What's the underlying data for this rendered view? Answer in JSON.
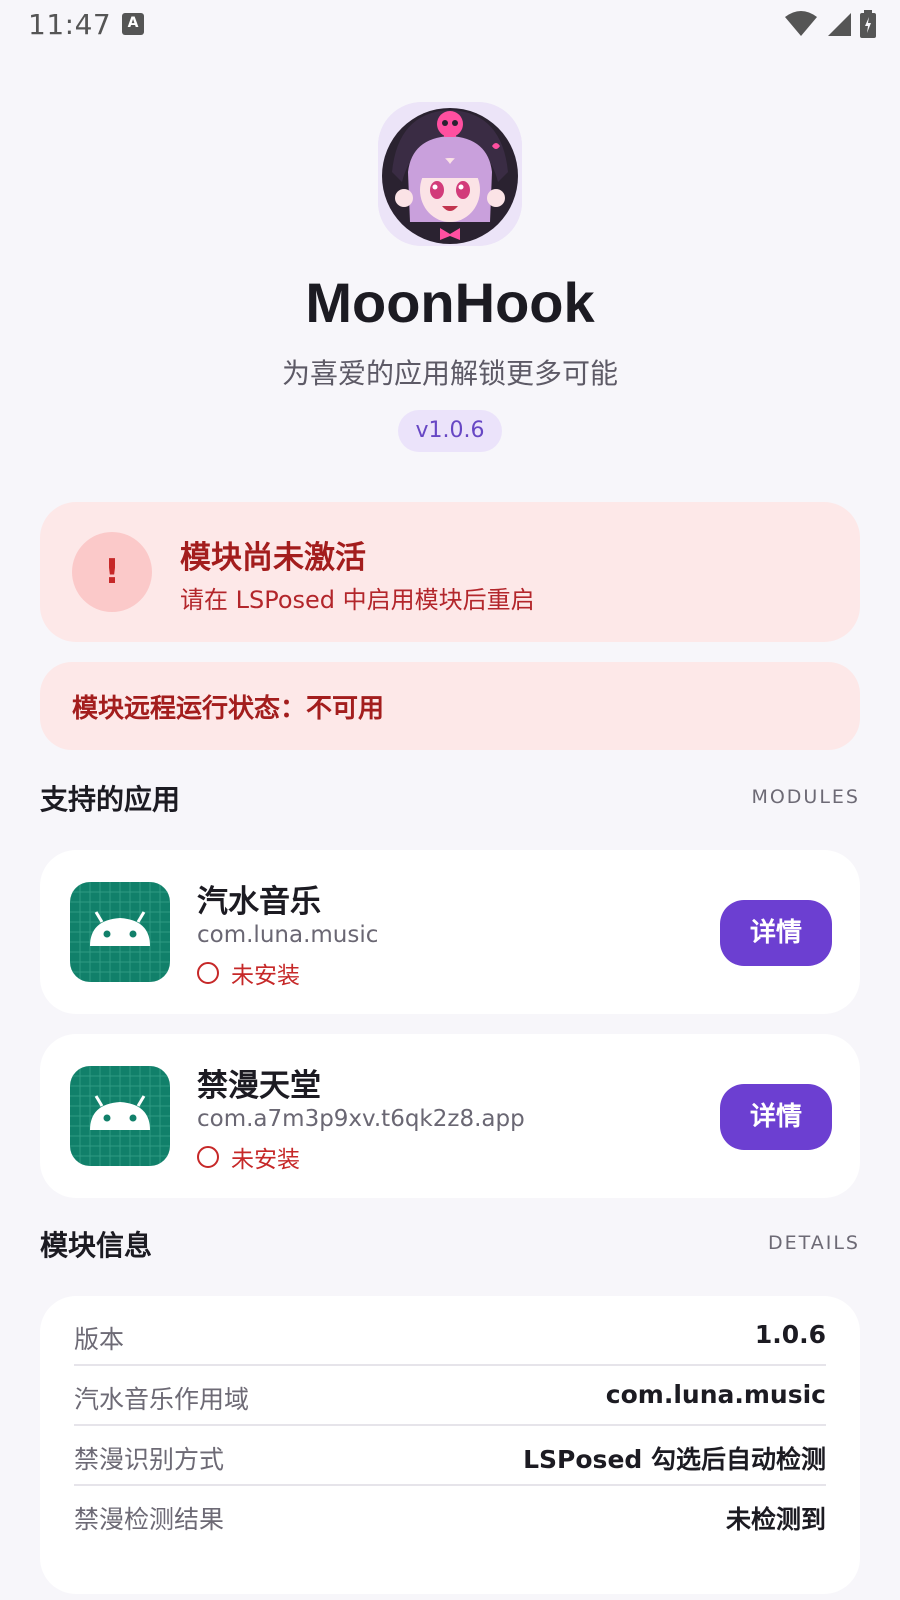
{
  "status_bar": {
    "time": "11:47",
    "notif_icon": "A"
  },
  "header": {
    "app_name": "MoonHook",
    "tagline": "为喜爱的应用解锁更多可能",
    "version": "v1.0.6"
  },
  "alert": {
    "icon": "!",
    "title": "模块尚未激活",
    "subtitle": "请在 LSPosed 中启用模块后重启"
  },
  "remote_status": {
    "text": "模块远程运行状态：不可用"
  },
  "supported_apps": {
    "title": "支持的应用",
    "tag": "MODULES",
    "items": [
      {
        "name": "汽水音乐",
        "package": "com.luna.music",
        "status": "未安装",
        "button": "详情"
      },
      {
        "name": "禁漫天堂",
        "package": "com.a7m3p9xv.t6qk2z8.app",
        "status": "未安装",
        "button": "详情"
      }
    ]
  },
  "module_info": {
    "title": "模块信息",
    "tag": "DETAILS",
    "rows": [
      {
        "label": "版本",
        "value": "1.0.6"
      },
      {
        "label": "汽水音乐作用域",
        "value": "com.luna.music"
      },
      {
        "label": "禁漫识别方式",
        "value": "LSPosed 勾选后自动检测"
      },
      {
        "label": "禁漫检测结果",
        "value": "未检测到"
      }
    ]
  },
  "colors": {
    "accent": "#6c3fd1",
    "alert_bg": "#fde8e8",
    "alert_text": "#a31d1d",
    "icon_teal": "#11806a"
  }
}
